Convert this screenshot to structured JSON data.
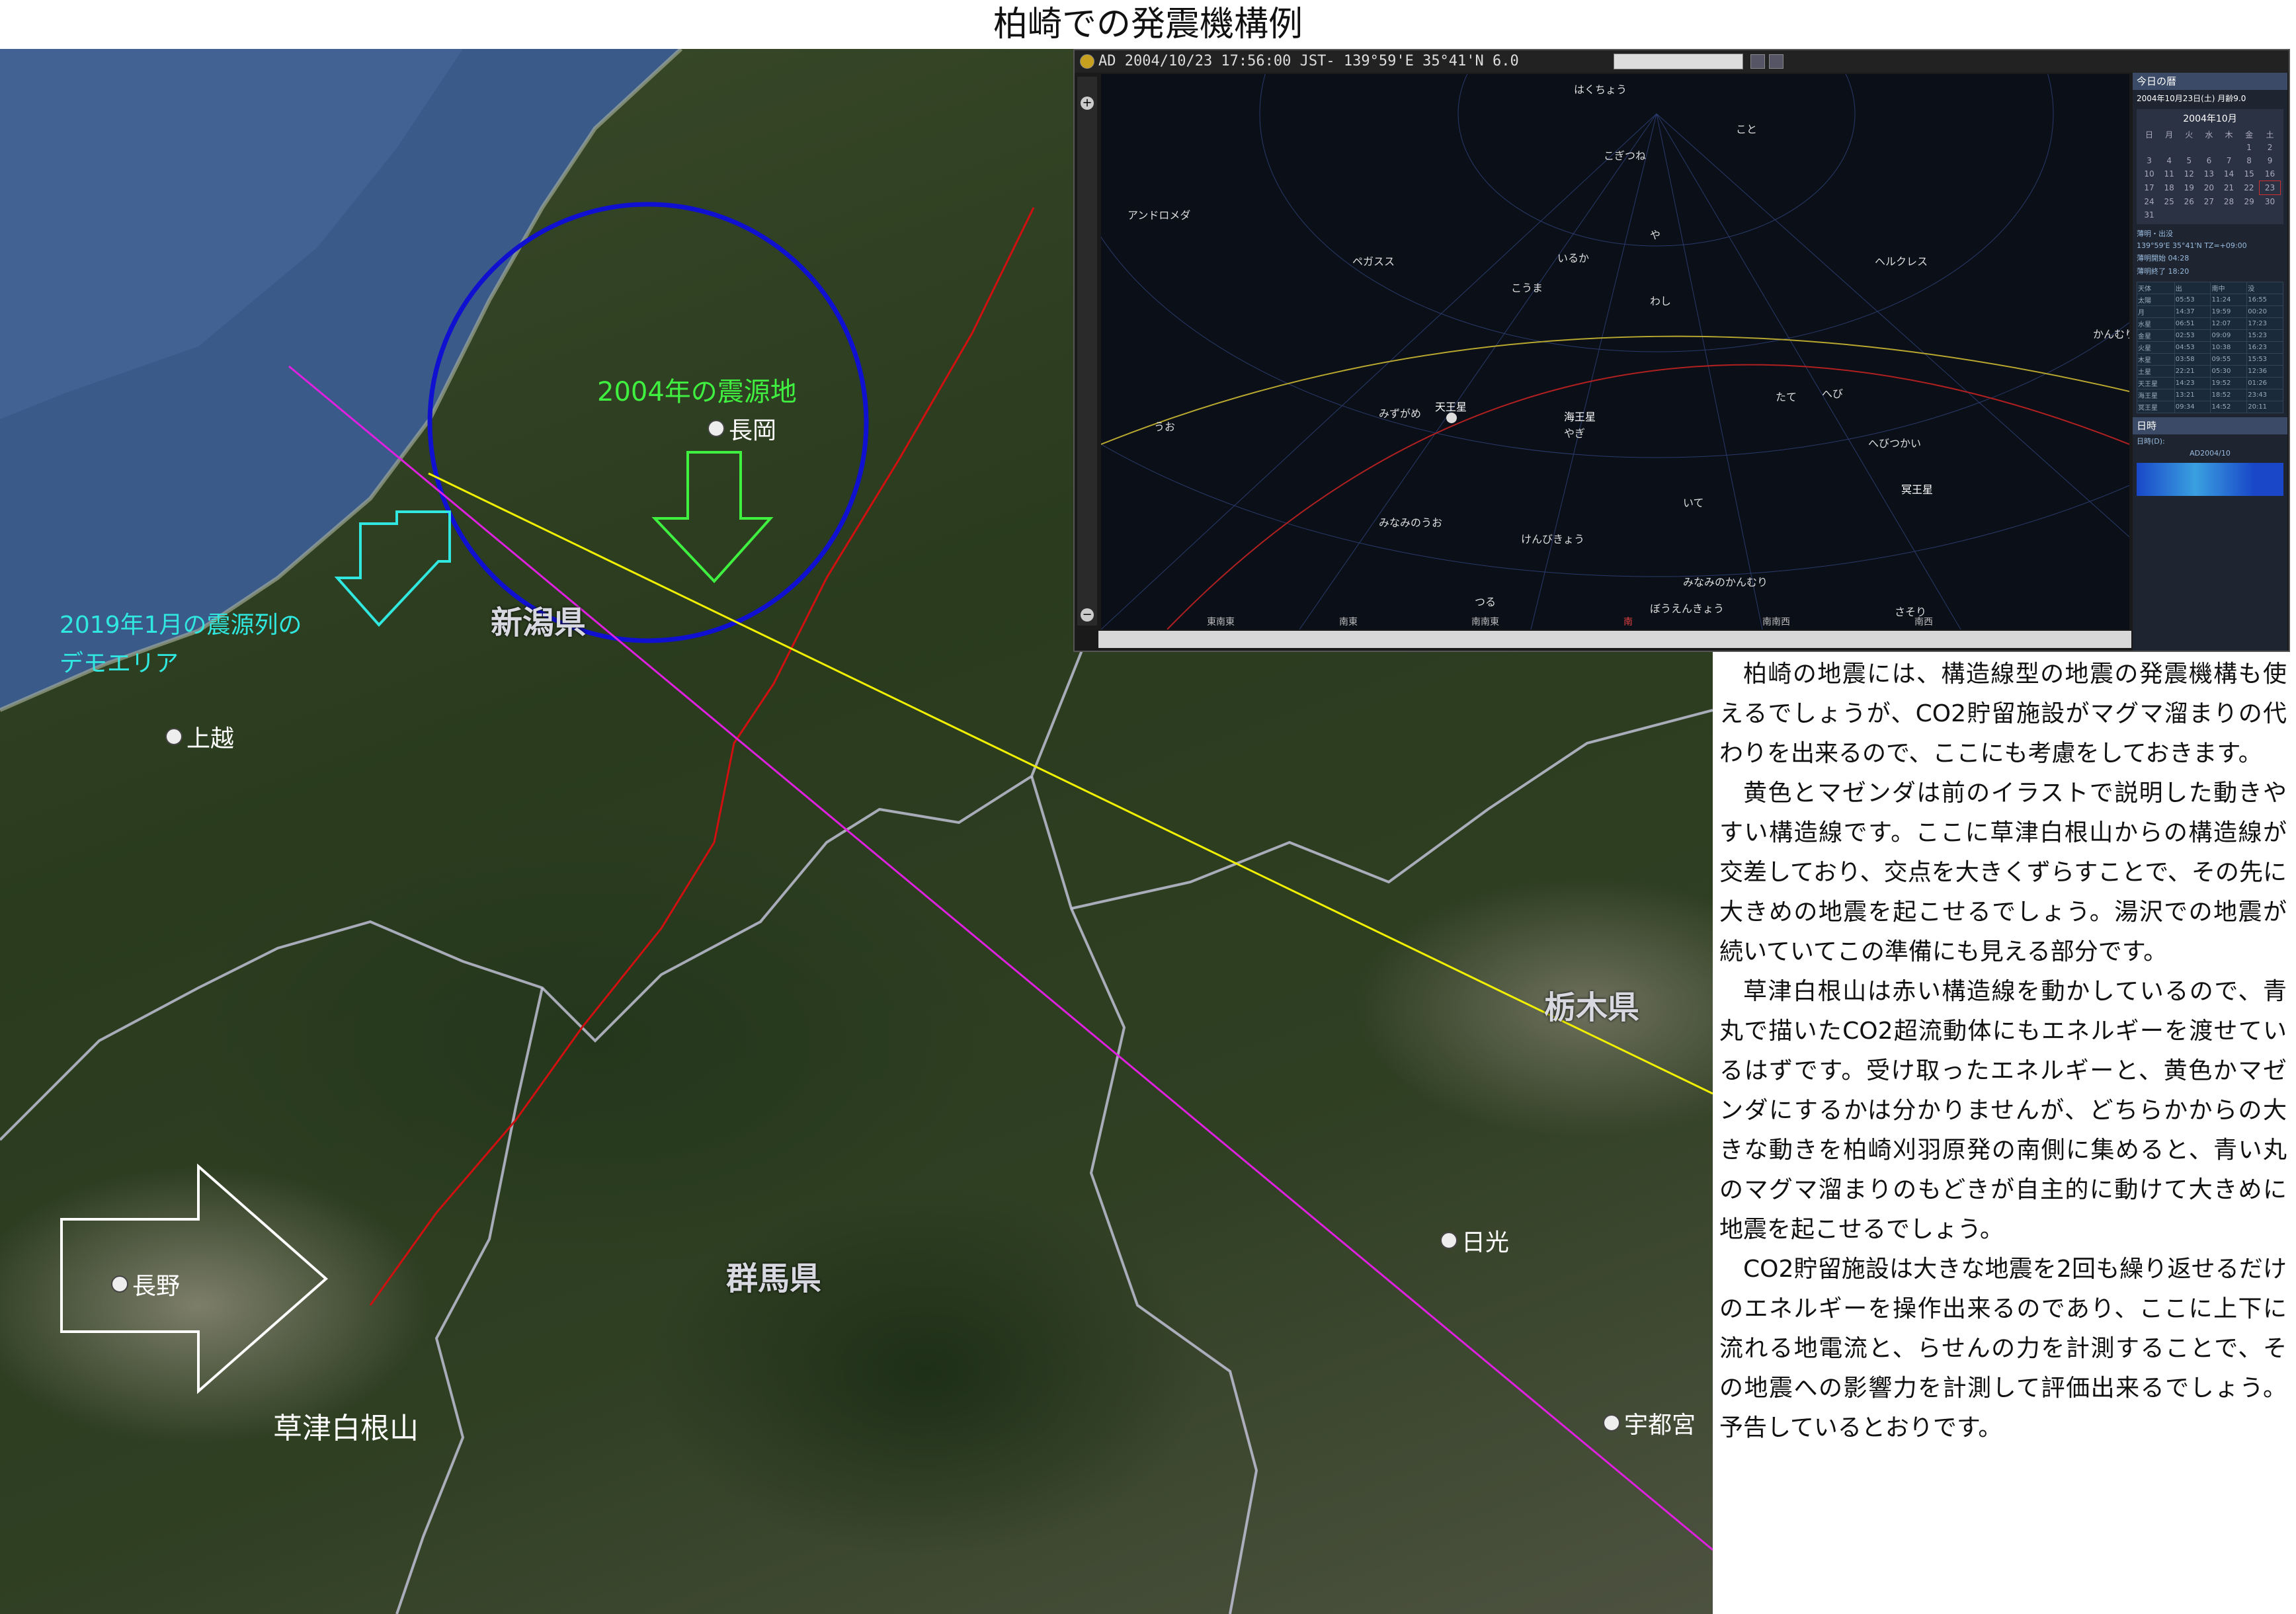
{
  "title": "柏崎での発震機構例",
  "map": {
    "labels": {
      "epicenter_2004": "2004年の震源地",
      "demo_area_line1": "2019年1月の震源列の",
      "demo_area_line2": "デモエリア",
      "mountain": "草津白根山"
    },
    "places": [
      "長岡",
      "上越",
      "長野",
      "日光",
      "宇都宮"
    ],
    "prefectures": [
      "新潟県",
      "群馬県",
      "栃木県"
    ],
    "colors": {
      "circle": "#1010d0",
      "yellow_line": "#f0f000",
      "magenta_line": "#e020e0",
      "red_line": "#d01010",
      "cyan_arrow": "#30e8e0",
      "green_arrow": "#40f040",
      "white_arrow": "#ffffff"
    }
  },
  "planetarium": {
    "status": "AD 2004/10/23  17:56:00  JST-  139°59'E  35°41'N  6.0",
    "sky_labels": [
      "はくちょう",
      "こと",
      "こぎつね",
      "アンドロメダ",
      "ペガスス",
      "いるか",
      "こうま",
      "や",
      "わし",
      "ヘルクレス",
      "かんむり",
      "うお",
      "みずがめ",
      "天王星",
      "海王星",
      "やぎ",
      "たて",
      "へび",
      "へびつかい",
      "冥王星",
      "みなみのうお",
      "けんびきょう",
      "いて",
      "みなみのかんむり",
      "つる",
      "ぼうえんきょう",
      "さそり"
    ],
    "directions": [
      "東南東",
      "南東",
      "南南東",
      "南",
      "南南西",
      "南西"
    ],
    "side": {
      "header": "今日の暦",
      "date_line": "2004年10月23日(土)  月齢9.0",
      "calendar_month": "2004年10月",
      "weekdays": [
        "日",
        "月",
        "火",
        "水",
        "木",
        "金",
        "土"
      ],
      "calendar_days": [
        "",
        "",
        "",
        "",
        "",
        "1",
        "2",
        "3",
        "4",
        "5",
        "6",
        "7",
        "8",
        "9",
        "10",
        "11",
        "12",
        "13",
        "14",
        "15",
        "16",
        "17",
        "18",
        "19",
        "20",
        "21",
        "22",
        "23",
        "24",
        "25",
        "26",
        "27",
        "28",
        "29",
        "30",
        "31"
      ],
      "twilight_header": "薄明・出没",
      "location": "139°59'E 35°41'N TZ=+09:00",
      "twilight_start": "薄明開始  04:28",
      "twilight_end": "薄明終了  18:20",
      "rs_header": [
        "天体",
        "出",
        "南中",
        "没"
      ],
      "rs_rows": [
        [
          "太陽",
          "05:53",
          "11:24",
          "16:55"
        ],
        [
          "月",
          "14:37",
          "19:59",
          "00:20"
        ],
        [
          "水星",
          "06:51",
          "12:07",
          "17:23"
        ],
        [
          "金星",
          "02:53",
          "09:09",
          "15:23"
        ],
        [
          "火星",
          "04:53",
          "10:38",
          "16:23"
        ],
        [
          "木星",
          "03:58",
          "09:55",
          "15:53"
        ],
        [
          "土星",
          "22:21",
          "05:30",
          "12:36"
        ],
        [
          "天王星",
          "14:23",
          "19:52",
          "01:26"
        ],
        [
          "海王星",
          "13:21",
          "18:52",
          "23:43"
        ],
        [
          "冥王星",
          "09:34",
          "14:52",
          "20:11"
        ]
      ],
      "time_header": "日時",
      "time_month": "AD2004/10",
      "time_line": "日時(D):"
    }
  },
  "text": [
    "柏崎の地震には、構造線型の地震の発震機構も使えるでしょうが、CO2貯留施設がマグマ溜まりの代わりを出来るので、ここにも考慮をしておきます。",
    "黄色とマゼンダは前のイラストで説明した動きやすい構造線です。ここに草津白根山からの構造線が交差しており、交点を大きくずらすことで、その先に大きめの地震を起こせるでしょう。湯沢での地震が続いていてこの準備にも見える部分です。",
    "草津白根山は赤い構造線を動かしているので、青丸で描いたCO2超流動体にもエネルギーを渡せているはずです。受け取ったエネルギーと、黄色かマゼンダにするかは分かりませんが、どちらかからの大きな動きを柏崎刈羽原発の南側に集めると、青い丸のマグマ溜まりのもどきが自主的に動けて大きめに地震を起こせるでしょう。",
    "CO2貯留施設は大きな地震を2回も繰り返せるだけのエネルギーを操作出来るのであり、ここに上下に流れる地電流と、らせんの力を計測することで、その地震への影響力を計測して評価出来るでしょう。予告しているとおりです。"
  ]
}
